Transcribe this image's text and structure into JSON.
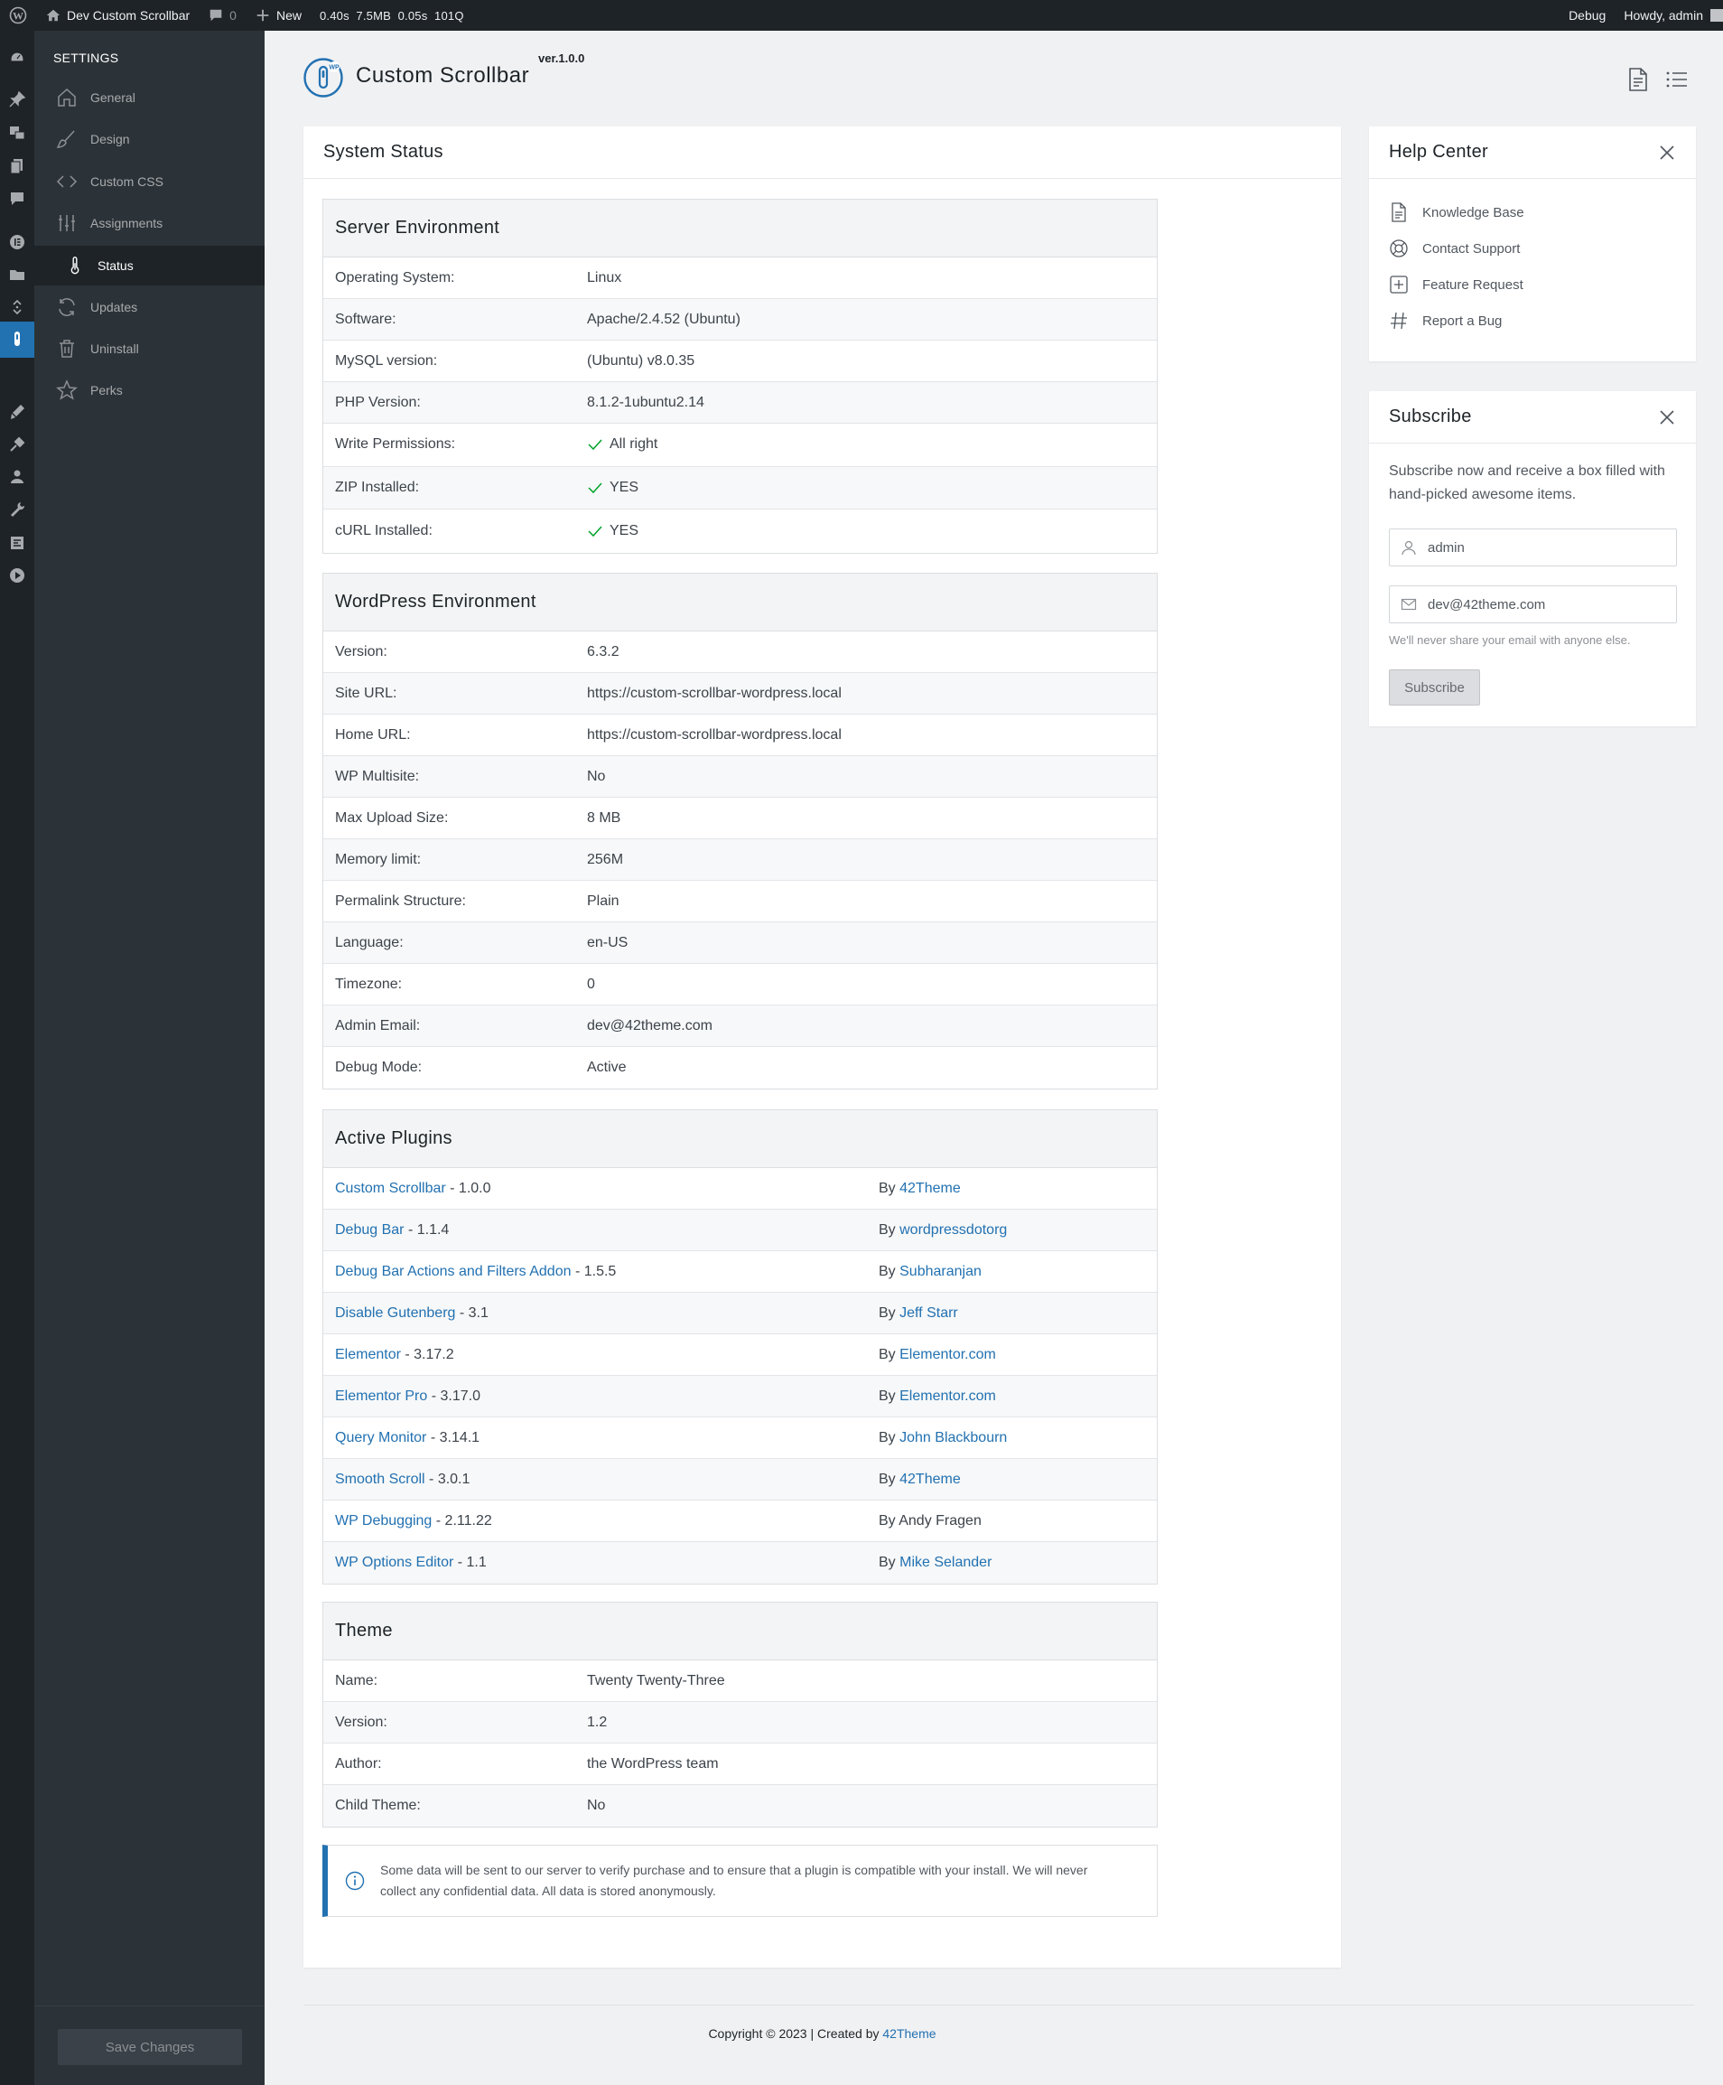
{
  "adminbar": {
    "site_name": "Dev Custom Scrollbar",
    "comments_count": "0",
    "new_label": "New",
    "perf_time": "0.40s",
    "perf_mem": "7.5MB",
    "perf_db_time": "0.05s",
    "perf_queries": "101Q",
    "debug_label": "Debug",
    "howdy": "Howdy, admin"
  },
  "sidebar": {
    "title": "SETTINGS",
    "items": [
      {
        "label": "General",
        "icon": "home-icon"
      },
      {
        "label": "Design",
        "icon": "brush-icon"
      },
      {
        "label": "Custom CSS",
        "icon": "code-icon"
      },
      {
        "label": "Assignments",
        "icon": "sliders-icon"
      },
      {
        "label": "Status",
        "icon": "thermometer-icon"
      },
      {
        "label": "Updates",
        "icon": "refresh-icon"
      },
      {
        "label": "Uninstall",
        "icon": "trash-icon"
      },
      {
        "label": "Perks",
        "icon": "star-icon"
      }
    ],
    "save_label": "Save Changes"
  },
  "header": {
    "title": "Custom Scrollbar",
    "version": "ver.1.0.0"
  },
  "status": {
    "title": "System Status",
    "server": {
      "title": "Server Environment",
      "rows": [
        {
          "k": "Operating System:",
          "v": "Linux"
        },
        {
          "k": "Software:",
          "v": "Apache/2.4.52 (Ubuntu)"
        },
        {
          "k": "MySQL version:",
          "v": "(Ubuntu) v8.0.35"
        },
        {
          "k": "PHP Version:",
          "v": "8.1.2-1ubuntu2.14"
        },
        {
          "k": "Write Permissions:",
          "v": "All right"
        },
        {
          "k": "ZIP Installed:",
          "v": "YES"
        },
        {
          "k": "cURL Installed:",
          "v": "YES"
        }
      ]
    },
    "wordpress": {
      "title": "WordPress Environment",
      "rows": [
        {
          "k": "Version:",
          "v": "6.3.2"
        },
        {
          "k": "Site URL:",
          "v": "https://custom-scrollbar-wordpress.local"
        },
        {
          "k": "Home URL:",
          "v": "https://custom-scrollbar-wordpress.local"
        },
        {
          "k": "WP Multisite:",
          "v": "No"
        },
        {
          "k": "Max Upload Size:",
          "v": "8 MB"
        },
        {
          "k": "Memory limit:",
          "v": "256M"
        },
        {
          "k": "Permalink Structure:",
          "v": "Plain"
        },
        {
          "k": "Language:",
          "v": "en-US"
        },
        {
          "k": "Timezone:",
          "v": "0"
        },
        {
          "k": "Admin Email:",
          "v": "dev@42theme.com"
        },
        {
          "k": "Debug Mode:",
          "v": "Active"
        }
      ]
    },
    "plugins": {
      "title": "Active Plugins",
      "rows": [
        {
          "name": "Custom Scrollbar",
          "ver": " - 1.0.0",
          "by": "By ",
          "author": "42Theme",
          "author_link": true
        },
        {
          "name": "Debug Bar",
          "ver": " - 1.1.4",
          "by": "By ",
          "author": "wordpressdotorg",
          "author_link": true
        },
        {
          "name": "Debug Bar Actions and Filters Addon",
          "ver": " - 1.5.5",
          "by": "By ",
          "author": "Subharanjan",
          "author_link": true
        },
        {
          "name": "Disable Gutenberg",
          "ver": " - 3.1",
          "by": "By ",
          "author": "Jeff Starr",
          "author_link": true
        },
        {
          "name": "Elementor",
          "ver": " - 3.17.2",
          "by": "By ",
          "author": "Elementor.com",
          "author_link": true
        },
        {
          "name": "Elementor Pro",
          "ver": " - 3.17.0",
          "by": "By ",
          "author": "Elementor.com",
          "author_link": true
        },
        {
          "name": "Query Monitor",
          "ver": " - 3.14.1",
          "by": "By ",
          "author": "John Blackbourn",
          "author_link": true
        },
        {
          "name": "Smooth Scroll",
          "ver": " - 3.0.1",
          "by": "By ",
          "author": "42Theme",
          "author_link": true
        },
        {
          "name": "WP Debugging",
          "ver": " - 2.11.22",
          "by": "By ",
          "author": "Andy Fragen",
          "author_link": false
        },
        {
          "name": "WP Options Editor",
          "ver": " - 1.1",
          "by": "By ",
          "author": "Mike Selander",
          "author_link": true
        }
      ]
    },
    "theme": {
      "title": "Theme",
      "rows": [
        {
          "k": "Name:",
          "v": "Twenty Twenty-Three"
        },
        {
          "k": "Version:",
          "v": "1.2"
        },
        {
          "k": "Author:",
          "v": "the WordPress team"
        },
        {
          "k": "Child Theme:",
          "v": "No"
        }
      ]
    },
    "notice": "Some data will be sent to our server to verify purchase and to ensure that a plugin is compatible with your install. We will never collect any confidential data. All data is stored anonymously."
  },
  "help": {
    "title": "Help Center",
    "items": [
      {
        "label": "Knowledge Base",
        "icon": "document-icon"
      },
      {
        "label": "Contact Support",
        "icon": "lifebuoy-icon"
      },
      {
        "label": "Feature Request",
        "icon": "plus-square-icon"
      },
      {
        "label": "Report a Bug",
        "icon": "hash-icon"
      }
    ]
  },
  "subscribe": {
    "title": "Subscribe",
    "text": "Subscribe now and receive a box filled with hand-picked awesome items.",
    "name_value": "admin",
    "email_value": "dev@42theme.com",
    "help": "We'll never share your email with anyone else.",
    "button": "Subscribe"
  },
  "footer": {
    "prefix": "Copyright © 2023 | Created by ",
    "link": "42Theme"
  },
  "colors": {
    "accent": "#2271b1",
    "adminbar": "#1d2327",
    "sidebar": "#2c3338",
    "check": "#00a32a"
  }
}
